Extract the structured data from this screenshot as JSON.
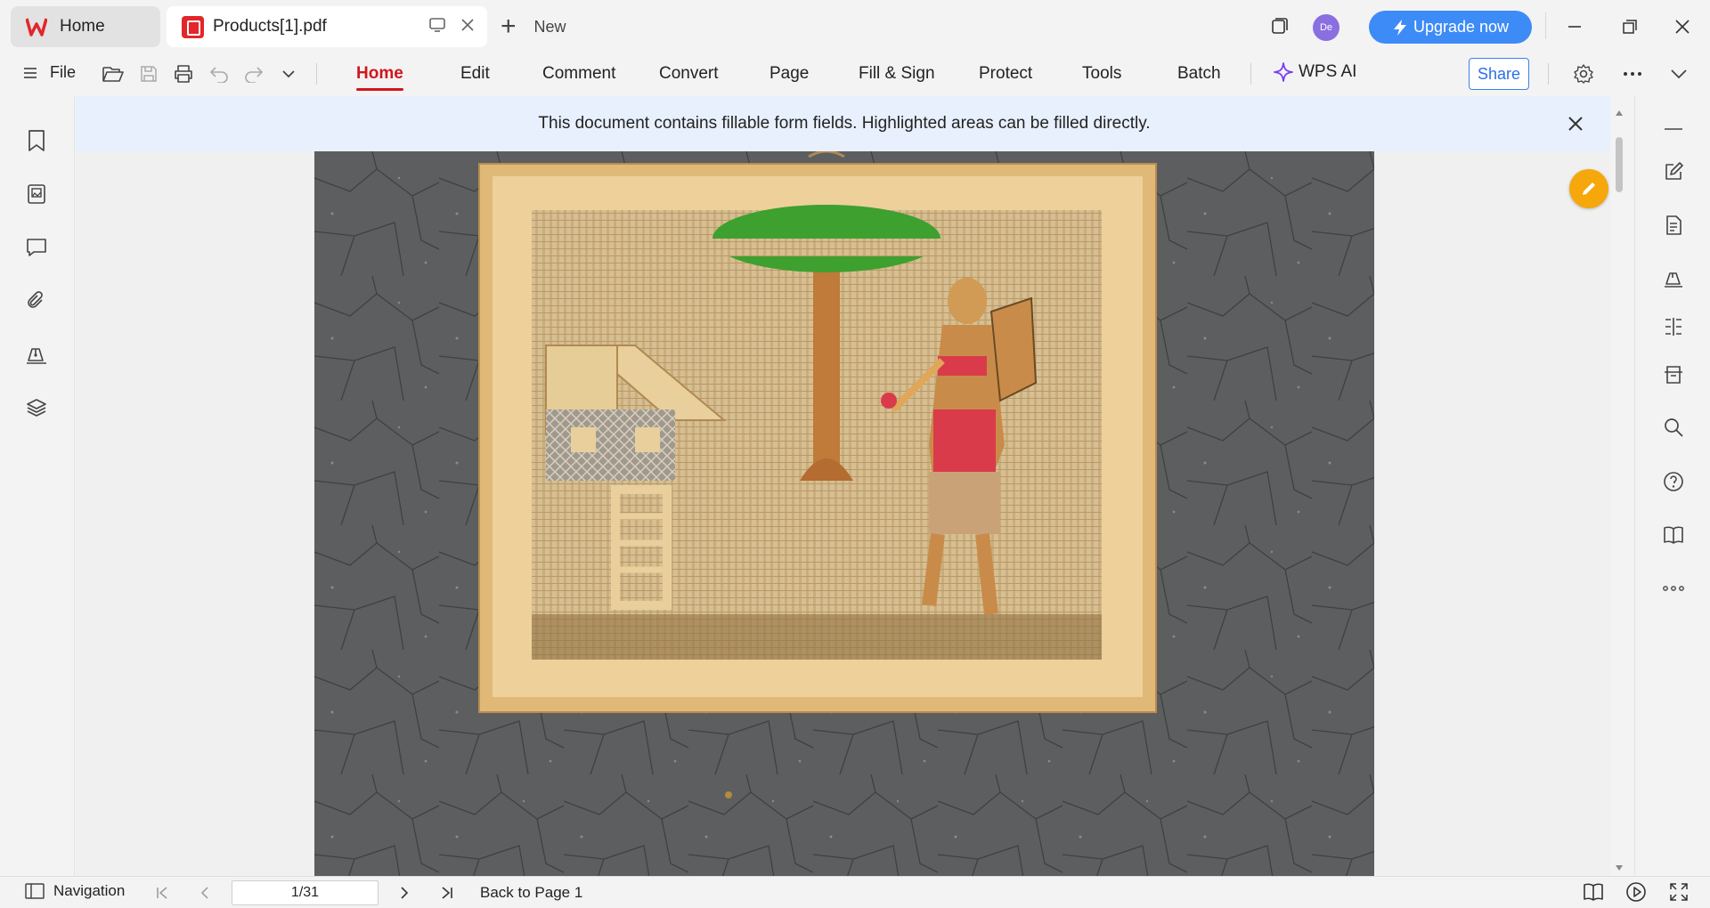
{
  "titlebar": {
    "home_tab": "Home",
    "doc_tab": "Products[1].pdf",
    "new_tab": "New",
    "avatar_initials": "De",
    "upgrade_label": "Upgrade now"
  },
  "ribbon": {
    "file_label": "File",
    "tabs": [
      "Home",
      "Edit",
      "Comment",
      "Convert",
      "Page",
      "Fill & Sign",
      "Protect",
      "Tools",
      "Batch"
    ],
    "active_tab": "Home",
    "ai_label": "WPS AI",
    "share_label": "Share"
  },
  "notice": {
    "text": "This document contains fillable form fields. Highlighted areas can be filled directly."
  },
  "statusbar": {
    "navigation_label": "Navigation",
    "page_indicator": "1/31",
    "back_label": "Back to Page 1"
  },
  "colors": {
    "accent_red": "#d0161d",
    "upgrade_blue": "#3d8bf7",
    "edit_fab": "#f5a70c",
    "notice_bg": "#e8f0fd"
  },
  "icons": {
    "left_sidebar": [
      "bookmark-icon",
      "thumbnails-icon",
      "comment-icon",
      "attachment-icon",
      "signature-icon",
      "layers-icon"
    ],
    "right_sidebar": [
      "minimize-panel-icon",
      "edit-text-icon",
      "document-icon",
      "sign-icon",
      "compare-icon",
      "scan-icon",
      "search-icon",
      "help-icon",
      "book-icon",
      "more-icon"
    ]
  }
}
